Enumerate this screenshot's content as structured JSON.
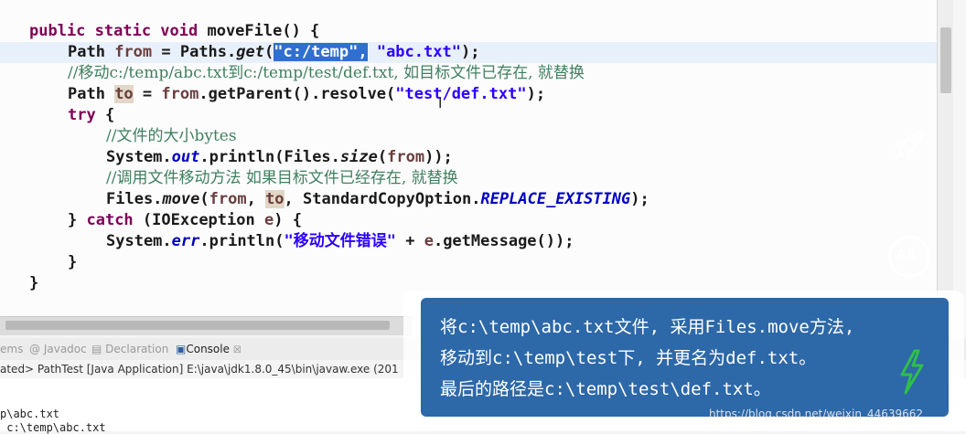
{
  "code": {
    "l1_kw1": "public static void",
    "l1_rest": " moveFile() {",
    "l2_a": "Path ",
    "l2_from": "from",
    "l2_b": " = Paths.",
    "l2_get": "get",
    "l2_paren": "(",
    "l2_sel": "\"c:/temp\",",
    "l2_str2": " \"abc.txt\"",
    "l2_end": ");",
    "l3_comment": "//移动c:/temp/abc.txt到c:/temp/test/def.txt, 如目标文件已存在, 就替换",
    "l4_a": "Path ",
    "l4_to": "to",
    "l4_b": " = ",
    "l4_from": "from",
    "l4_c": ".getParent().resolve(",
    "l4_str": "\"test/def.txt\"",
    "l4_end": ");",
    "l5_kw": "try",
    "l5_rest": " {",
    "l6_comment": "//文件的大小bytes",
    "l7_a": "System.",
    "l7_out": "out",
    "l7_b": ".println(Files.",
    "l7_size": "size",
    "l7_c": "(",
    "l7_from": "from",
    "l7_end": "));",
    "l8_comment": "//调用文件移动方法 如果目标文件已经存在, 就替换",
    "l9_a": "Files.",
    "l9_move": "move",
    "l9_b": "(",
    "l9_from": "from",
    "l9_c": ", ",
    "l9_to": "to",
    "l9_d": ", StandardCopyOption.",
    "l9_const": "REPLACE_EXISTING",
    "l9_end": ");",
    "l10_a": "} ",
    "l10_kw": "catch",
    "l10_b": " (IOException ",
    "l10_e": "e",
    "l10_end": ") {",
    "l11_a": "System.",
    "l11_err": "err",
    "l11_b": ".println(",
    "l11_str": "\"移动文件错误\"",
    "l11_c": " + ",
    "l11_e": "e",
    "l11_end": ".getMessage());",
    "l12": "}",
    "l13": "}"
  },
  "console": {
    "tab_items": "ems",
    "tab_javadoc": "Javadoc",
    "tab_declaration": "Declaration",
    "tab_console": "Console",
    "tab_console_x": "☒",
    "status": "ated> PathTest [Java Application] E:\\java\\jdk1.8.0_45\\bin\\javaw.exe (201",
    "out1": "p\\abc.txt",
    "out2": " c:\\temp\\abc.txt"
  },
  "bubble": {
    "line1": "将c:\\temp\\abc.txt文件, 采用Files.move方法,",
    "line2": "移动到c:\\temp\\test下, 并更名为def.txt。",
    "line3": "最后的路径是c:\\temp\\test\\def.txt。"
  },
  "side": {
    "ab_label": "AB"
  },
  "watermark": "https://blog.csdn.net/weixin_44639662",
  "icons": [
    "rocket-icon",
    "translate-icon",
    "lightning-icon"
  ],
  "colors": {
    "keyword": "#7f0055",
    "string": "#2a00ff",
    "comment": "#3f7f5f",
    "field": "#0000c0",
    "selection": "#2f6fd0",
    "bubble": "#2d68a8",
    "bolt": "#2fbf4a"
  }
}
